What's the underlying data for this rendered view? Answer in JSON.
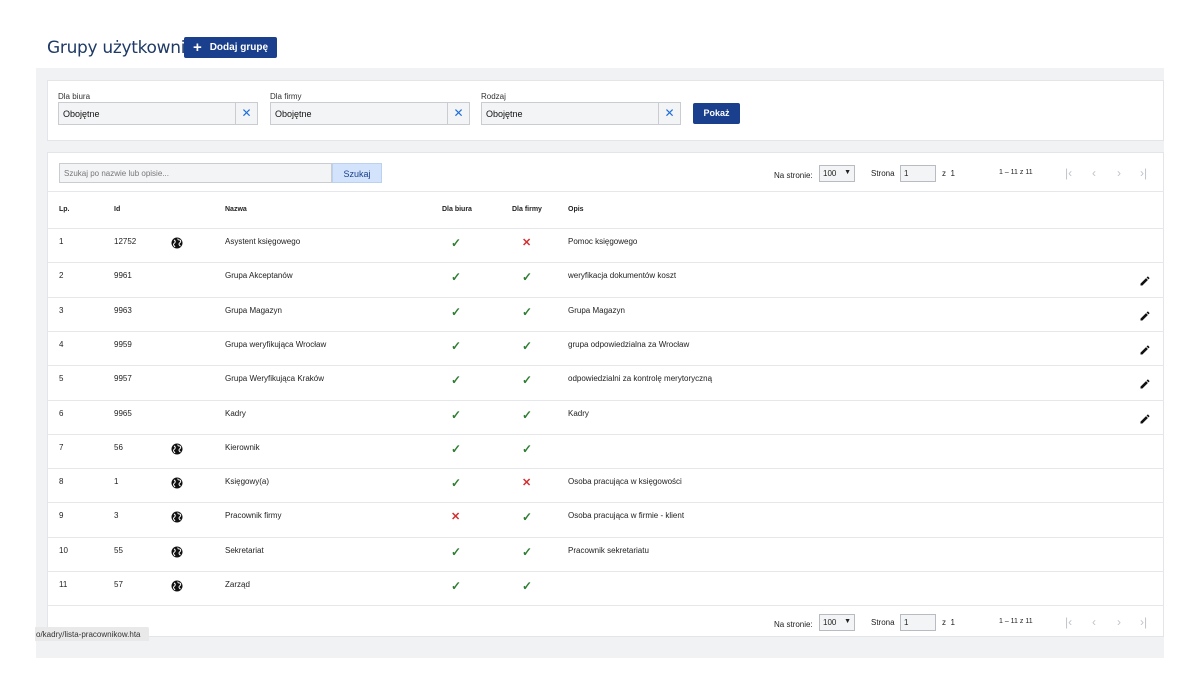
{
  "header": {
    "title": "Grupy użytkowników",
    "add_label": "Dodaj grupę"
  },
  "filters": [
    {
      "label": "Dla biura",
      "value": "Obojętne"
    },
    {
      "label": "Dla firmy",
      "value": "Obojętne"
    },
    {
      "label": "Rodzaj",
      "value": "Obojętne"
    }
  ],
  "show_label": "Pokaż",
  "search": {
    "placeholder": "Szukaj po nazwie lub opisie...",
    "button": "Szukaj"
  },
  "pager": {
    "per_page_label": "Na stronie:",
    "per_page": "100",
    "page_label": "Strona",
    "page": "1",
    "of_label": "z",
    "of": "1",
    "range": "1 – 11 z 11"
  },
  "columns": {
    "lp": "Lp.",
    "id": "Id",
    "name": "Nazwa",
    "office": "Dla biura",
    "company": "Dla firmy",
    "desc": "Opis"
  },
  "rows": [
    {
      "lp": "1",
      "id": "12752",
      "globe": true,
      "name": "Asystent księgowego",
      "office": true,
      "company": false,
      "desc": "Pomoc księgowego",
      "edit": false
    },
    {
      "lp": "2",
      "id": "9961",
      "globe": false,
      "name": "Grupa Akceptanów",
      "office": true,
      "company": true,
      "desc": "weryfikacja dokumentów koszt",
      "edit": true
    },
    {
      "lp": "3",
      "id": "9963",
      "globe": false,
      "name": "Grupa Magazyn",
      "office": true,
      "company": true,
      "desc": "Grupa Magazyn",
      "edit": true
    },
    {
      "lp": "4",
      "id": "9959",
      "globe": false,
      "name": "Grupa weryfikująca Wrocław",
      "office": true,
      "company": true,
      "desc": "grupa odpowiedzialna za Wrocław",
      "edit": true
    },
    {
      "lp": "5",
      "id": "9957",
      "globe": false,
      "name": "Grupa Weryfikująca Kraków",
      "office": true,
      "company": true,
      "desc": "odpowiedzialni za kontrolę merytoryczną",
      "edit": true
    },
    {
      "lp": "6",
      "id": "9965",
      "globe": false,
      "name": "Kadry",
      "office": true,
      "company": true,
      "desc": "Kadry",
      "edit": true
    },
    {
      "lp": "7",
      "id": "56",
      "globe": true,
      "name": "Kierownik",
      "office": true,
      "company": true,
      "desc": "",
      "edit": false
    },
    {
      "lp": "8",
      "id": "1",
      "globe": true,
      "name": "Księgowy(a)",
      "office": true,
      "company": false,
      "desc": "Osoba pracująca w księgowości",
      "edit": false
    },
    {
      "lp": "9",
      "id": "3",
      "globe": true,
      "name": "Pracownik firmy",
      "office": false,
      "company": true,
      "desc": "Osoba pracująca w firmie - klient",
      "edit": false
    },
    {
      "lp": "10",
      "id": "55",
      "globe": true,
      "name": "Sekretariat",
      "office": true,
      "company": true,
      "desc": "Pracownik sekretariatu",
      "edit": false
    },
    {
      "lp": "11",
      "id": "57",
      "globe": true,
      "name": "Zarząd",
      "office": true,
      "company": true,
      "desc": "",
      "edit": false
    }
  ],
  "status_url": "o/kadry/lista-pracownikow.hta"
}
